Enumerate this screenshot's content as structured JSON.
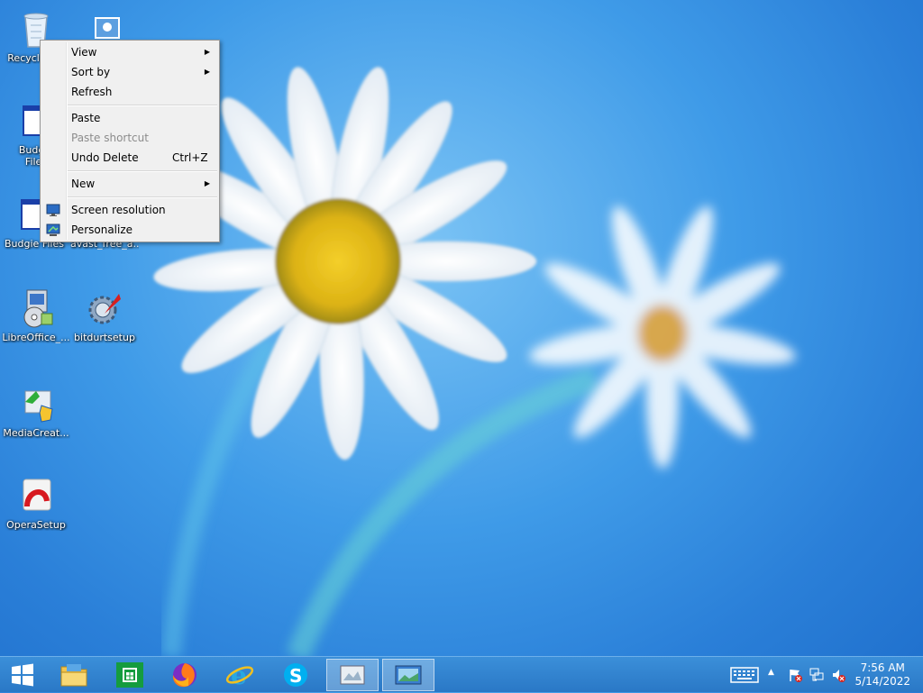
{
  "desktop": {
    "icons": [
      {
        "label": "Recycle Bin",
        "icon": "recycle-bin-icon"
      },
      {
        "label": "Budgie Files",
        "icon": "folder-window-icon"
      },
      {
        "label": "Budgie Files",
        "icon": "folder-window-icon"
      },
      {
        "label": "avast_free_a...",
        "icon": "installer-icon"
      },
      {
        "label": "LibreOffice_...",
        "icon": "libreoffice-installer-icon"
      },
      {
        "label": "bitdurtsetup",
        "icon": "setup-gear-icon"
      },
      {
        "label": "MediaCreat...",
        "icon": "media-creation-tool-icon"
      },
      {
        "label": "OperaSetup",
        "icon": "opera-setup-icon"
      }
    ]
  },
  "context_menu": {
    "items": [
      {
        "label": "View",
        "submenu": true
      },
      {
        "label": "Sort by",
        "submenu": true
      },
      {
        "label": "Refresh"
      },
      {
        "label": "Paste"
      },
      {
        "label": "Paste shortcut",
        "disabled": true
      },
      {
        "label": "Undo Delete",
        "shortcut": "Ctrl+Z"
      },
      {
        "label": "New",
        "submenu": true
      },
      {
        "label": "Screen resolution",
        "icon": "screen-resolution-icon"
      },
      {
        "label": "Personalize",
        "icon": "personalize-icon"
      }
    ]
  },
  "taskbar": {
    "pinned": [
      "start-icon",
      "file-explorer-icon",
      "store-icon",
      "firefox-icon",
      "internet-explorer-icon",
      "skype-icon",
      "window-app-icon",
      "window-app-icon"
    ],
    "tray": [
      "keyboard-icon",
      "show-hidden-icons",
      "action-center-flag-icon",
      "network-icon",
      "volume-muted-icon"
    ],
    "clock": {
      "time": "7:56 AM",
      "date": "5/14/2022"
    }
  },
  "colors": {
    "taskbar": "#2a78c6",
    "menu_bg": "#f0f0f0",
    "desktop": "#3f9be8"
  }
}
